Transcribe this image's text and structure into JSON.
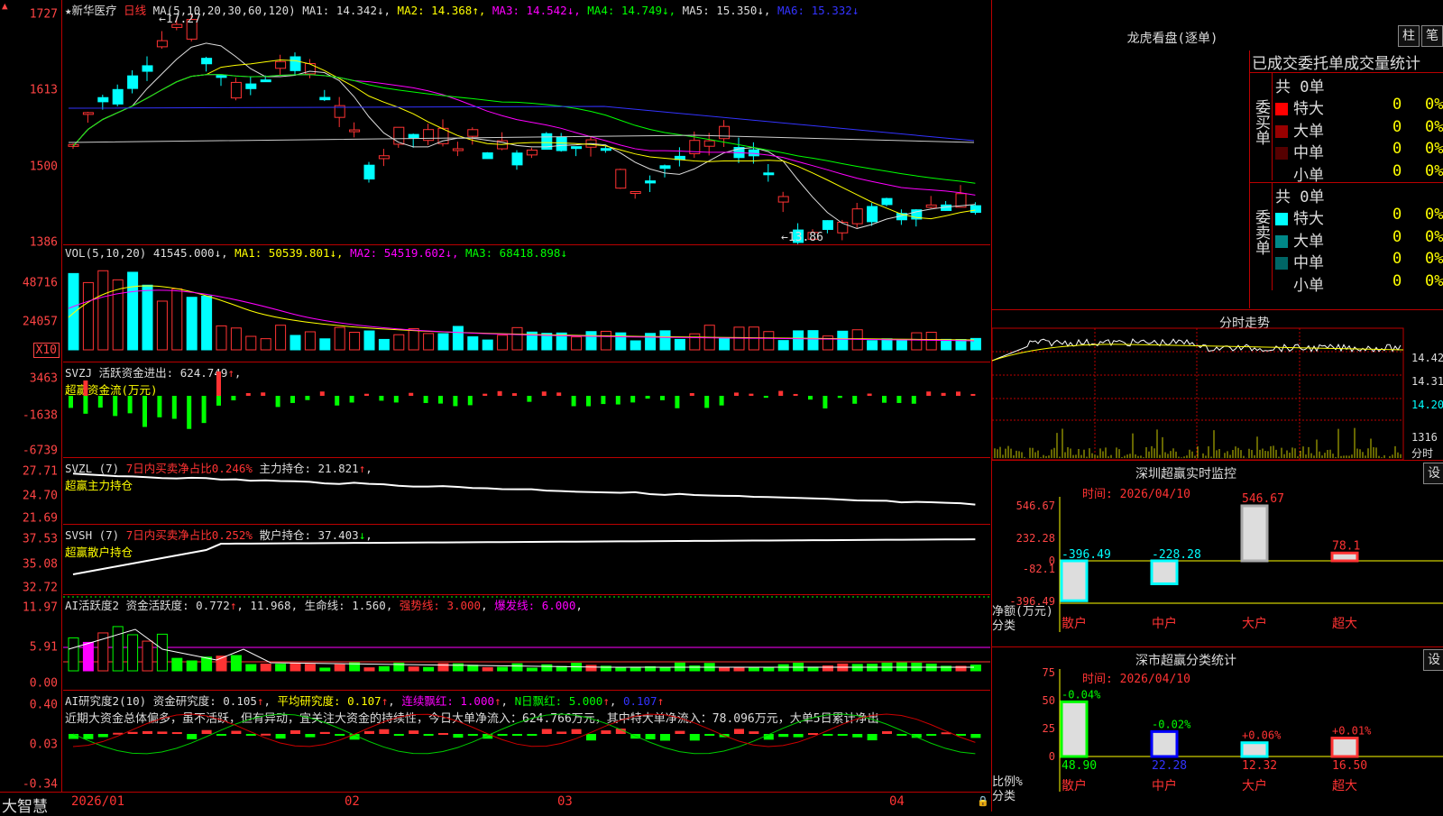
{
  "corner_mark": "▲",
  "k": {
    "title": "★新华医疗",
    "period": "日线",
    "ma_label": "MA(5,10,20,30,60,120)",
    "ma": [
      {
        "name": "MA1:",
        "value": "14.342",
        "arrow": "↓",
        "color": "#dddddd"
      },
      {
        "name": "MA2:",
        "value": "14.368",
        "arrow": "↑",
        "color": "#ffff00"
      },
      {
        "name": "MA3:",
        "value": "14.542",
        "arrow": "↓",
        "color": "#ff00ff"
      },
      {
        "name": "MA4:",
        "value": "14.749",
        "arrow": "↓",
        "color": "#00ff00"
      },
      {
        "name": "MA5:",
        "value": "15.350",
        "arrow": "↓",
        "color": "#dddddd"
      },
      {
        "name": "MA6:",
        "value": "15.332",
        "arrow": "↓",
        "color": "#3333ff"
      }
    ],
    "yticks": [
      "1727",
      "1613",
      "1500",
      "1386"
    ],
    "high_label": "17.27",
    "low_label": "13.86"
  },
  "vol": {
    "label": "VOL(5,10,20)",
    "value": "41545.000",
    "arrow": "↓",
    "ma": [
      {
        "name": "MA1:",
        "value": "50539.801",
        "arrow": "↓",
        "color": "#ffff00"
      },
      {
        "name": "MA2:",
        "value": "54519.602",
        "arrow": "↓",
        "color": "#ff00ff"
      },
      {
        "name": "MA3:",
        "value": "68418.898",
        "arrow": "↓",
        "color": "#00ff00"
      }
    ],
    "yticks": [
      "48716",
      "24057"
    ],
    "unit": "X10"
  },
  "svzj": {
    "label": "SVZJ",
    "desc": "活跃资金进出:",
    "value": "624.749",
    "arrow": "↑",
    "sub": "超赢资金流(万元)",
    "yticks": [
      "3463",
      "-1638",
      "-6739"
    ]
  },
  "svzl": {
    "label": "SVZL (7)",
    "desc": "7日内买卖净占比0.246%",
    "name2": "主力持仓:",
    "value": "21.821",
    "arrow": "↑",
    "sub": "超赢主力持仓",
    "yticks": [
      "27.71",
      "24.70",
      "21.69"
    ]
  },
  "svsh": {
    "label": "SVSH (7)",
    "desc": "7日内买卖净占比0.252%",
    "name2": "散户持仓:",
    "value": "37.403",
    "arrow": "↓",
    "sub": "超赢散户持仓",
    "yticks": [
      "37.53",
      "35.08",
      "32.72"
    ]
  },
  "ai1": {
    "label": "AI活跃度2",
    "desc": "资金活跃度:",
    "value": "0.772",
    "arrow": "↑",
    "v2": "11.968",
    "life": "生命线:",
    "life_v": "1.560",
    "strong": "强势线:",
    "strong_v": "3.000",
    "burst": "爆发线:",
    "burst_v": "6.000",
    "yticks": [
      "11.97",
      "5.91",
      "0.00"
    ]
  },
  "ai2": {
    "label": "AI研究度2(10)",
    "desc": "资金研究度:",
    "value": "0.105",
    "avg": "平均研究度:",
    "avg_v": "0.107",
    "cont": "连续飘红:",
    "cont_v": "1.000",
    "nday": "N日飘红:",
    "nday_v": "5.000",
    "last": "0.107",
    "comment": "近期大资金总体偏多，虽不活跃，但有异动，宜关注大资金的持续性，今日大单净流入：624.766万元，其中特大单净流入：78.096万元，大单5日累计净出",
    "yticks": [
      "0.40",
      "0.03",
      "-0.34"
    ]
  },
  "xaxis": {
    "brand": "大智慧",
    "labels": [
      "2026/01",
      "02",
      "03",
      "04"
    ]
  },
  "lhb": {
    "title": "龙虎看盘(逐单)",
    "btn1": "柱",
    "btn2": "笔",
    "subtitle": "已成交委托单成交量统计",
    "buy": {
      "side": "委买单",
      "total": "共 0单",
      "rows": [
        {
          "name": "特大",
          "count": "0",
          "pct": "0%",
          "color": "#ff0000"
        },
        {
          "name": "大单",
          "count": "0",
          "pct": "0%",
          "color": "#990000"
        },
        {
          "name": "中单",
          "count": "0",
          "pct": "0%",
          "color": "#550000"
        },
        {
          "name": "小单",
          "count": "0",
          "pct": "0%",
          "color": ""
        }
      ]
    },
    "sell": {
      "side": "委卖单",
      "total": "共 0单",
      "rows": [
        {
          "name": "特大",
          "count": "0",
          "pct": "0%",
          "color": "#00ffff"
        },
        {
          "name": "大单",
          "count": "0",
          "pct": "0%",
          "color": "#008888"
        },
        {
          "name": "中单",
          "count": "0",
          "pct": "0%",
          "color": "#006666"
        },
        {
          "name": "小单",
          "count": "0",
          "pct": "0%",
          "color": ""
        }
      ]
    }
  },
  "intraday": {
    "title": "分时走势",
    "yticks": [
      "14.42",
      "14.31",
      "14.20"
    ],
    "vol_label": "1316",
    "vol_unit": "分时"
  },
  "sz_monitor": {
    "title": "深圳超赢实时监控",
    "btn": "设",
    "time": "时间: 2026/04/10",
    "yticks": [
      "546.67",
      "232.28",
      "0",
      "-82.1",
      "-396.49"
    ],
    "ylabel": "净额(万元)",
    "xlabel": "分类",
    "bars": [
      {
        "name": "散户",
        "value": "-396.49"
      },
      {
        "name": "中户",
        "value": "-228.28"
      },
      {
        "name": "大户",
        "value": "546.67"
      },
      {
        "name": "超大",
        "value": "78.1"
      }
    ]
  },
  "sz_class": {
    "title": "深市超赢分类统计",
    "btn": "设",
    "time": "时间: 2026/04/10",
    "yticks": [
      "75",
      "50",
      "25",
      "0"
    ],
    "ylabel": "比例%",
    "xlabel": "分类",
    "bars": [
      {
        "name": "散户",
        "value": "48.90",
        "change": "-0.04%"
      },
      {
        "name": "中户",
        "value": "22.28",
        "change": "-0.02%"
      },
      {
        "name": "大户",
        "value": "12.32",
        "change": "+0.06%"
      },
      {
        "name": "超大",
        "value": "16.50",
        "change": "+0.01%"
      }
    ]
  }
}
